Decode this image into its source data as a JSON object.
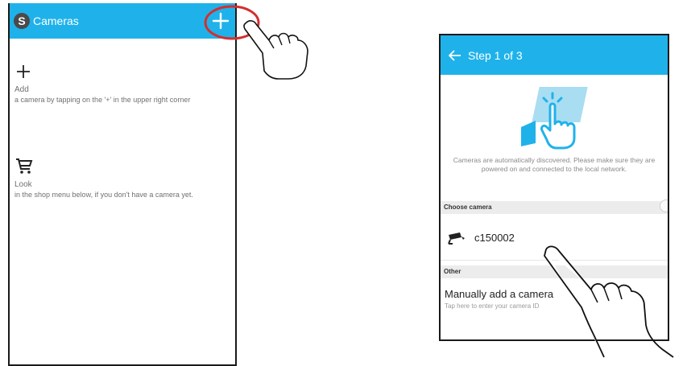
{
  "left_screen": {
    "header": {
      "logo_letter": "S",
      "title": "Cameras",
      "add_icon": "plus-icon"
    },
    "add_block": {
      "icon": "plus-icon",
      "title": "Add",
      "text": "a camera by tapping on the '+' in the upper right corner"
    },
    "look_block": {
      "icon": "shopping-cart-icon",
      "title": "Look",
      "text": "in the shop menu below, if you don't have a camera yet."
    }
  },
  "right_screen": {
    "header": {
      "back_icon": "arrow-left-icon",
      "title": "Step 1 of 3"
    },
    "hero_icon": "tap-hand-icon",
    "discover_text": "Cameras are automatically discovered. Please make sure they are powered on and connected to the local network.",
    "choose_header": "Choose camera",
    "camera": {
      "icon": "security-camera-icon",
      "name": "c150002"
    },
    "other_header": "Other",
    "manual": {
      "title": "Manually add a camera",
      "subtitle": "Tap here to enter your camera ID"
    }
  },
  "annotations": {
    "highlight_color": "#d32f2f",
    "accent_color": "#1fb2ea"
  }
}
